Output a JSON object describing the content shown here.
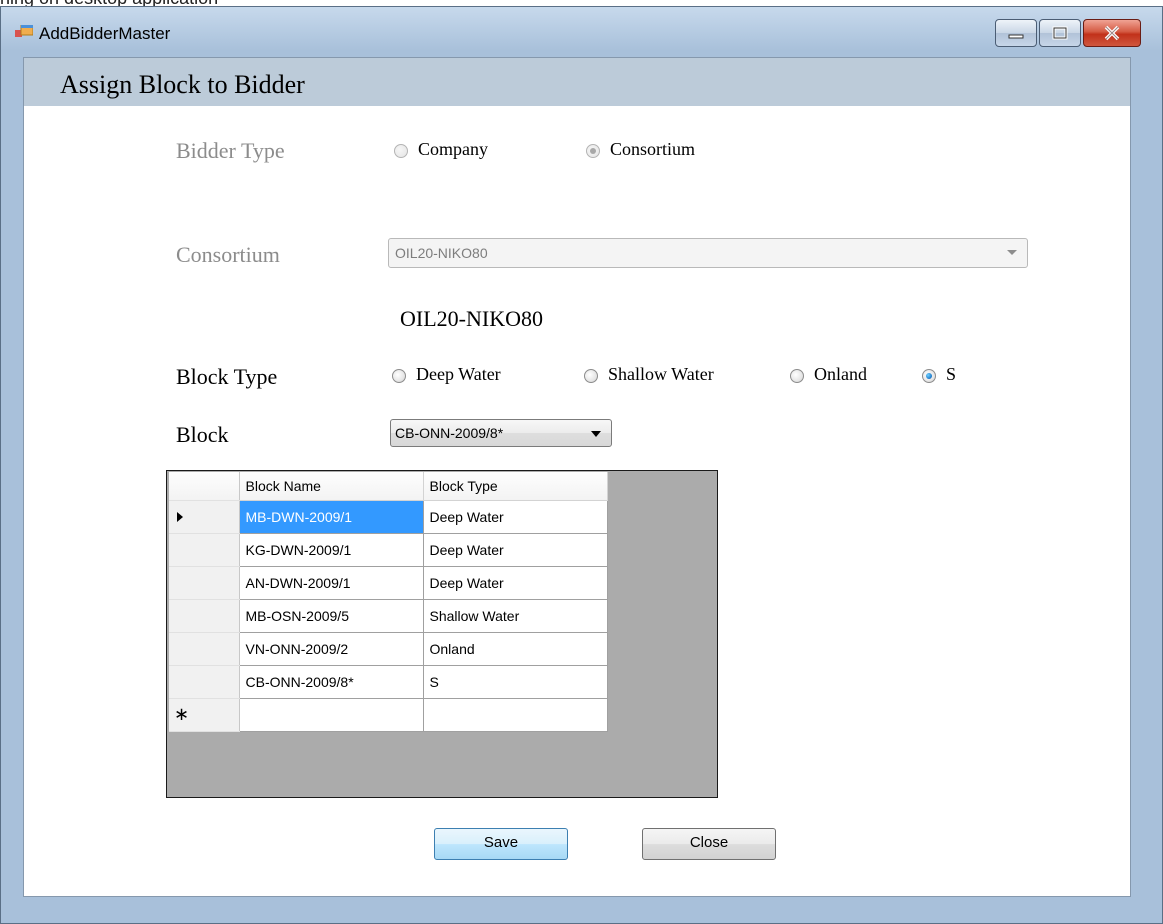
{
  "window": {
    "title": "AddBidderMaster",
    "snippet_text": "ning on desktop application"
  },
  "form": {
    "heading": "Assign Block to Bidder",
    "bidder_type": {
      "label": "Bidder Type",
      "options": [
        "Company",
        "Consortium"
      ],
      "selected": "Consortium",
      "enabled": false
    },
    "consortium": {
      "label": "Consortium",
      "value": "OIL20-NIKO80",
      "enabled": false
    },
    "consortium_display": "OIL20-NIKO80",
    "block_type": {
      "label": "Block Type",
      "options": [
        "Deep Water",
        "Shallow Water",
        "Onland",
        "S"
      ],
      "selected": "S"
    },
    "block": {
      "label": "Block",
      "value": "CB-ONN-2009/8*"
    }
  },
  "grid": {
    "columns": [
      "Block Name",
      "Block Type"
    ],
    "rows": [
      [
        "MB-DWN-2009/1",
        "Deep Water"
      ],
      [
        "KG-DWN-2009/1",
        "Deep Water"
      ],
      [
        "AN-DWN-2009/1",
        "Deep Water"
      ],
      [
        "MB-OSN-2009/5",
        "Shallow Water"
      ],
      [
        "VN-ONN-2009/2",
        "Onland"
      ],
      [
        "CB-ONN-2009/8*",
        "S"
      ]
    ],
    "new_row_marker": "∗",
    "selected_cell_color": "#3399ff"
  },
  "buttons": {
    "save": "Save",
    "close": "Close"
  },
  "colors": {
    "header_strip": "#bccbd9",
    "window_frame": "#a8c0da",
    "grid_background": "#ababab"
  }
}
